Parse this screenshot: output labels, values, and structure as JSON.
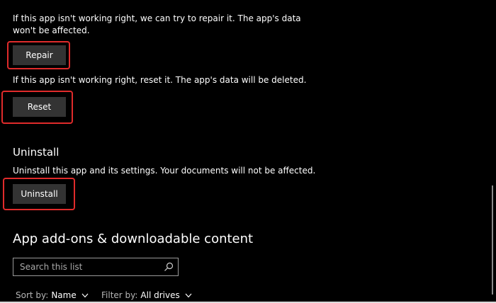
{
  "repair": {
    "description_line1": "If this app isn't working right, we can try to repair it. The app's data",
    "description_line2": "won't be affected.",
    "button_label": "Repair"
  },
  "reset": {
    "description": "If this app isn't working right, reset it. The app's data will be deleted.",
    "button_label": "Reset"
  },
  "uninstall": {
    "heading": "Uninstall",
    "description": "Uninstall this app and its settings. Your documents will not be affected.",
    "button_label": "Uninstall"
  },
  "addons": {
    "heading": "App add-ons & downloadable content",
    "search_placeholder": "Search this list",
    "sort_label": "Sort by:",
    "sort_value": "Name",
    "filter_label": "Filter by:",
    "filter_value": "All drives"
  },
  "colors": {
    "background": "#000000",
    "button": "#333333",
    "highlight": "#e02b2b"
  },
  "icons": [
    "search-icon",
    "chevron-down-icon"
  ]
}
